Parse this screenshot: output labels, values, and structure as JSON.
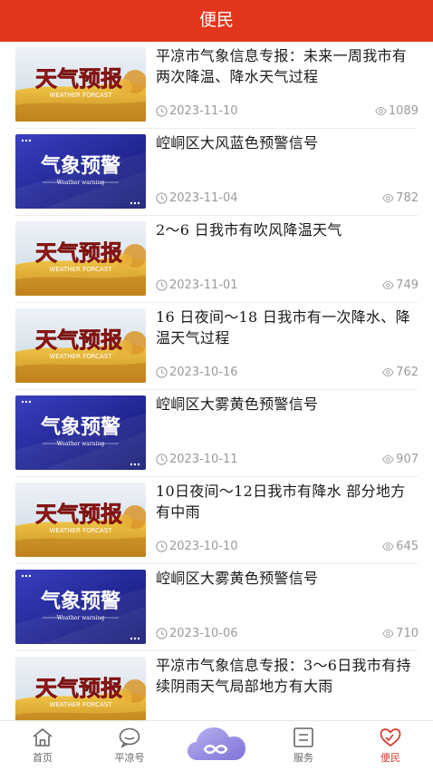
{
  "header": {
    "title": "便民"
  },
  "items": [
    {
      "title": "平凉市气象信息专报：未来一周我市有两次降温、降水天气过程",
      "date": "2023-11-10",
      "views": "1089",
      "thumb": "weather-forecast"
    },
    {
      "title": "崆峒区大风蓝色预警信号",
      "date": "2023-11-04",
      "views": "782",
      "thumb": "weather-warning"
    },
    {
      "title": "2～6 日我市有吹风降温天气",
      "date": "2023-11-01",
      "views": "749",
      "thumb": "weather-forecast"
    },
    {
      "title": "16 日夜间～18 日我市有一次降水、降温天气过程",
      "date": "2023-10-16",
      "views": "762",
      "thumb": "weather-forecast"
    },
    {
      "title": "崆峒区大雾黄色预警信号",
      "date": "2023-10-11",
      "views": "907",
      "thumb": "weather-warning"
    },
    {
      "title": "10日夜间～12日我市有降水 部分地方有中雨",
      "date": "2023-10-10",
      "views": "645",
      "thumb": "weather-forecast"
    },
    {
      "title": "崆峒区大雾黄色预警信号",
      "date": "2023-10-06",
      "views": "710",
      "thumb": "weather-warning"
    },
    {
      "title": "平凉市气象信息专报：3～6日我市有持续阴雨天气局部地方有大雨",
      "date": "",
      "views": "",
      "thumb": "weather-forecast"
    }
  ],
  "thumb_text": {
    "forecast_cn": "天气预报",
    "forecast_en": "WEATHER FORCAST",
    "warning_cn": "气象预警",
    "warning_en": "Weather warning"
  },
  "tabs": [
    {
      "label": "首页",
      "icon": "home-icon"
    },
    {
      "label": "平凉号",
      "icon": "chat-icon"
    },
    {
      "label": "",
      "icon": "cloud-logo-icon"
    },
    {
      "label": "服务",
      "icon": "service-icon"
    },
    {
      "label": "便民",
      "icon": "heart-hands-icon",
      "active": true
    }
  ],
  "colors": {
    "brand": "#e2361c",
    "active_tab": "#d63a2a",
    "meta": "#9a9a9a"
  }
}
